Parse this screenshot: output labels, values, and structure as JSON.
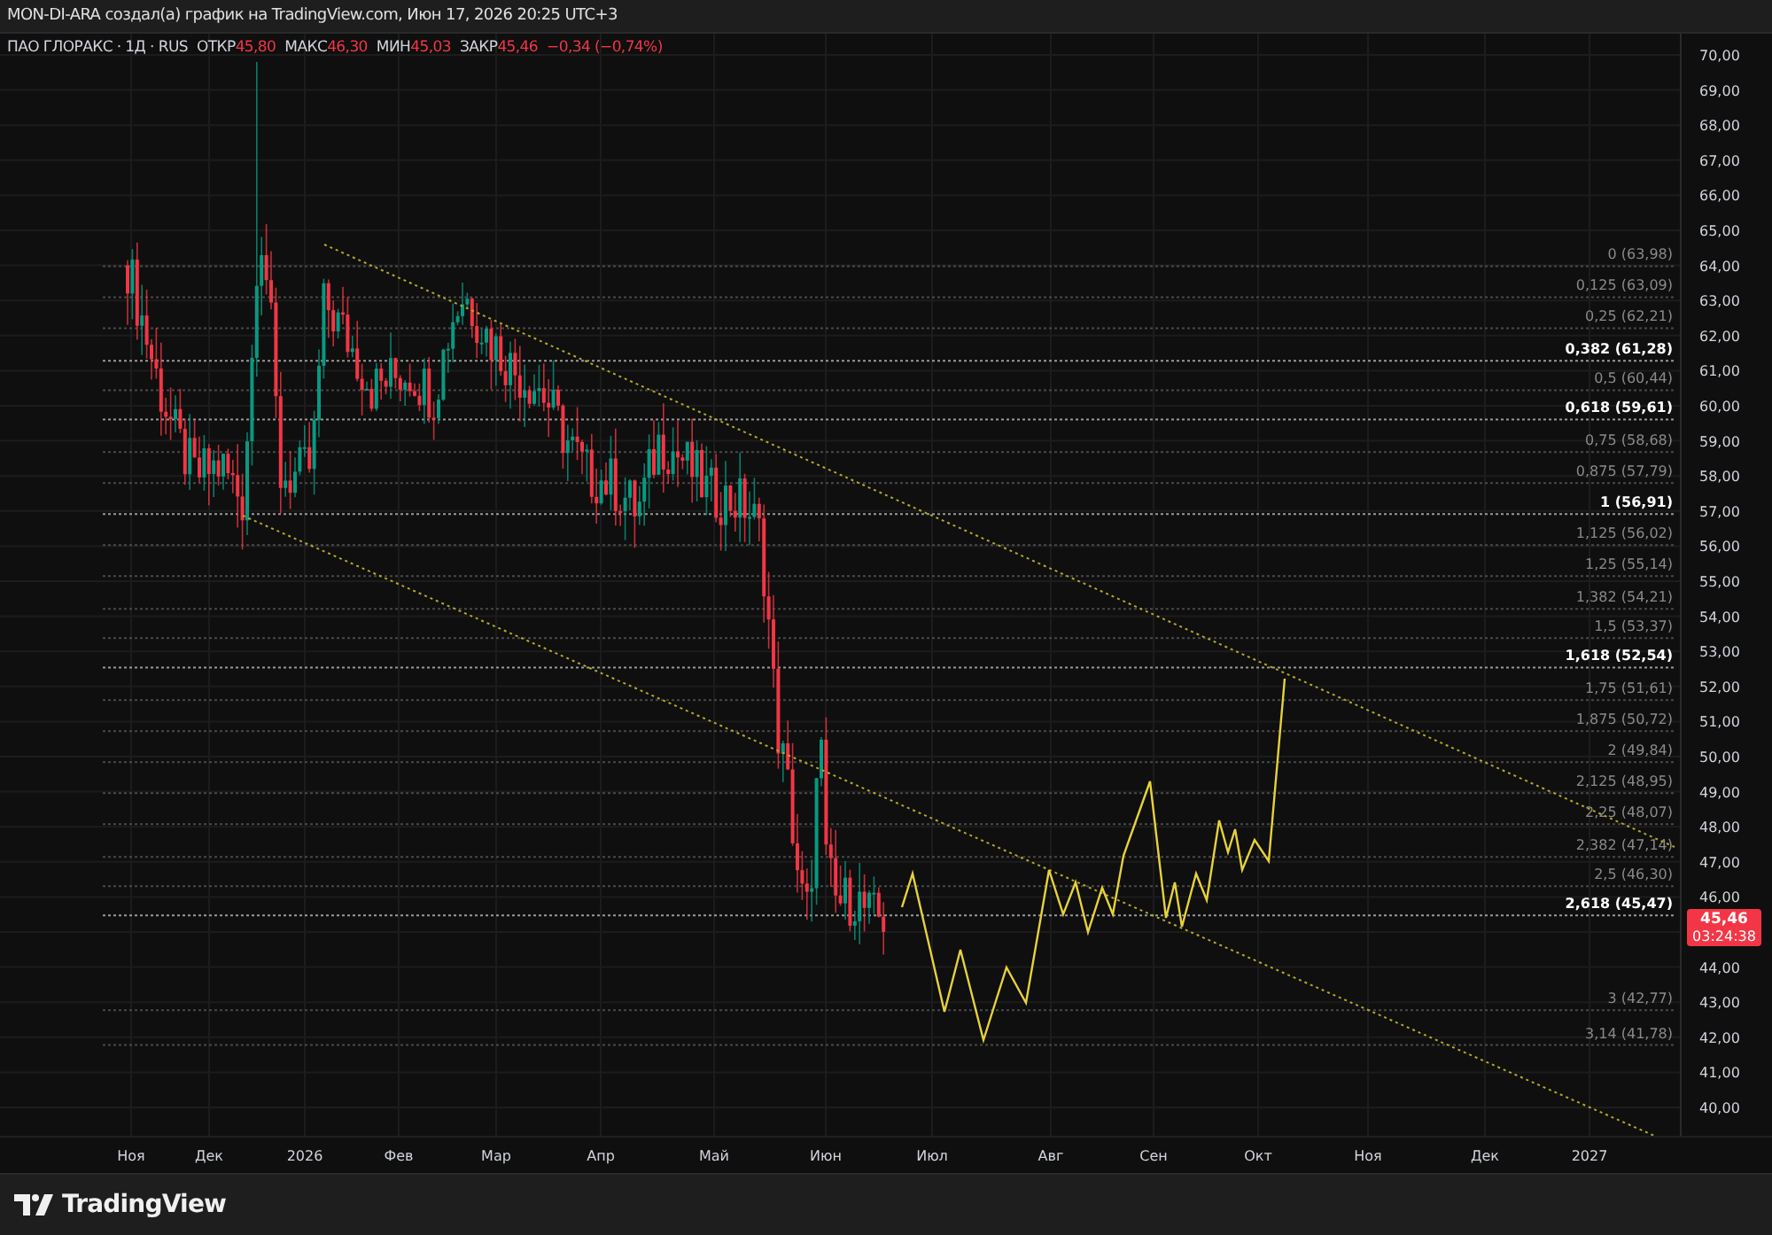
{
  "header": {
    "title": "MON-DI-ARA создал(а) график на TradingView.com, Июн 17, 2026 20:25 UTC+3"
  },
  "legend": {
    "symbol": "ПАО ГЛОРАКС · 1Д · RUS",
    "fields": [
      {
        "label": "ОТКР",
        "value": "45,80"
      },
      {
        "label": "МАКС",
        "value": "46,30"
      },
      {
        "label": "МИН",
        "value": "45,03"
      },
      {
        "label": "ЗАКР",
        "value": "45,46"
      }
    ],
    "change": "−0,34 (−0,74%)"
  },
  "fib_levels": [
    {
      "label": "0 (63,98)",
      "highlighted": false
    },
    {
      "label": "0,125 (63,09)",
      "highlighted": false
    },
    {
      "label": "0,25 (62,21)",
      "highlighted": false
    },
    {
      "label": "0,382 (61,28)",
      "highlighted": true
    },
    {
      "label": "0,5 (60,44)",
      "highlighted": false
    },
    {
      "label": "0,618 (59,61)",
      "highlighted": true
    },
    {
      "label": "0,75 (58,68)",
      "highlighted": false
    },
    {
      "label": "0,875 (57,79)",
      "highlighted": false
    },
    {
      "label": "1 (56,91)",
      "highlighted": true
    },
    {
      "label": "1,125 (56,02)",
      "highlighted": false
    },
    {
      "label": "1,25 (55,14)",
      "highlighted": false
    },
    {
      "label": "1,382 (54,21)",
      "highlighted": false
    },
    {
      "label": "1,5 (53,37)",
      "highlighted": false
    },
    {
      "label": "1,618 (52,54)",
      "highlighted": true
    },
    {
      "label": "1,75 (51,61)",
      "highlighted": false
    },
    {
      "label": "1,875 (50,72)",
      "highlighted": false
    },
    {
      "label": "2 (49,84)",
      "highlighted": false
    },
    {
      "label": "2,125 (48,95)",
      "highlighted": false
    },
    {
      "label": "2,25 (48,07)",
      "highlighted": false
    },
    {
      "label": "2,382 (47,14)",
      "highlighted": false
    },
    {
      "label": "2,5 (46,30)",
      "highlighted": false
    },
    {
      "label": "2,618 (45,47)",
      "highlighted": true
    },
    {
      "label": "3 (42,77)",
      "highlighted": false
    },
    {
      "label": "3,14 (41,78)",
      "highlighted": false
    }
  ],
  "price_axis": {
    "labels": [
      "70,00",
      "69,00",
      "68,00",
      "67,00",
      "66,00",
      "65,00",
      "64,00",
      "63,00",
      "62,00",
      "61,00",
      "60,00",
      "59,00",
      "58,00",
      "57,00",
      "56,00",
      "55,00",
      "54,00",
      "53,00",
      "52,00",
      "51,00",
      "50,00",
      "49,00",
      "48,00",
      "47,00",
      "46,00",
      "44,00",
      "43,00",
      "42,00",
      "41,00",
      "40,00"
    ]
  },
  "last_price": {
    "price": "45,46",
    "countdown": "03:24:38"
  },
  "time_axis": {
    "labels": [
      "Ноя",
      "Дек",
      "2026",
      "Фев",
      "Мар",
      "Апр",
      "Май",
      "Июн",
      "Июл",
      "Авг",
      "Сен",
      "Окт",
      "Ноя",
      "Дек",
      "2027"
    ]
  },
  "footer": {
    "brand": "TradingView"
  }
}
